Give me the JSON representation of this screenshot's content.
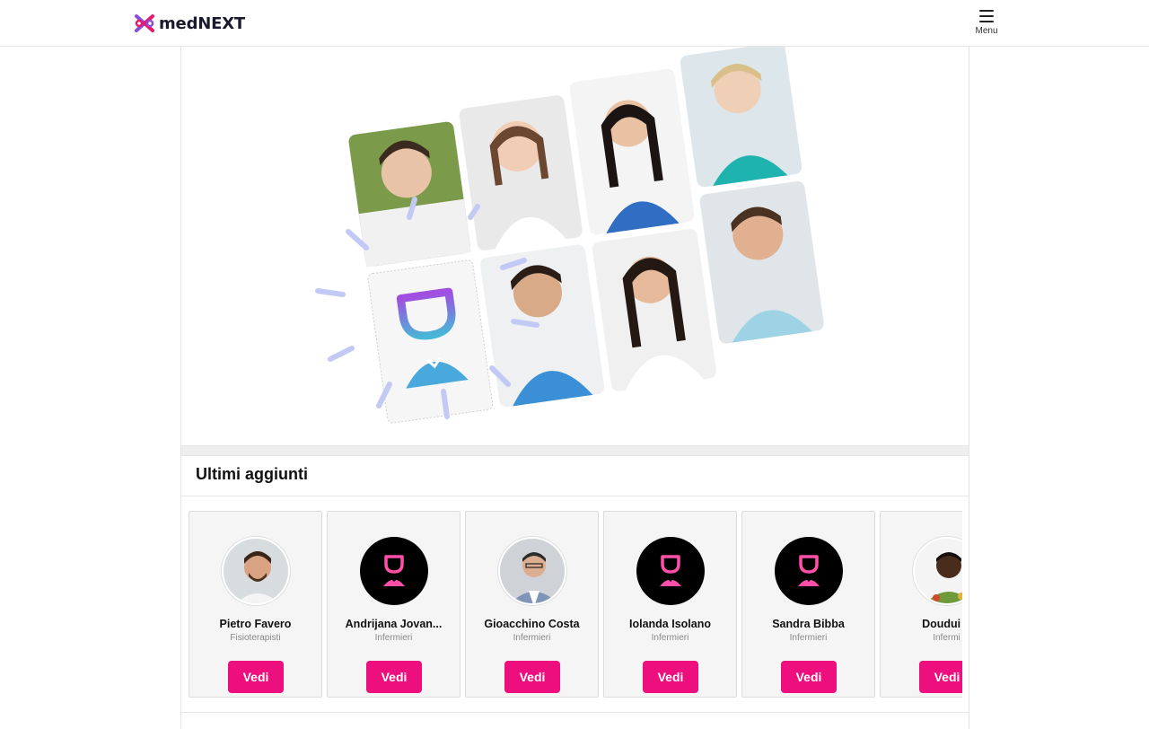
{
  "header": {
    "brand": "medNEXT",
    "menu_label": "Menu"
  },
  "colors": {
    "accent": "#ec0f7d",
    "logo_pink": "#e8186f",
    "logo_purple": "#8a4dd6",
    "placeholder_purple": "#9b4fe0",
    "placeholder_blue": "#4ab3d8"
  },
  "section": {
    "title": "Ultimi aggiunti"
  },
  "cards": [
    {
      "name": "Pietro Favero",
      "role": "Fisioterapisti",
      "button": "Vedi",
      "avatar": "photo"
    },
    {
      "name": "Andrijana Jovan...",
      "role": "Infermieri",
      "button": "Vedi",
      "avatar": "placeholder"
    },
    {
      "name": "Gioacchino Costa",
      "role": "Infermieri",
      "button": "Vedi",
      "avatar": "photo"
    },
    {
      "name": "Iolanda Isolano",
      "role": "Infermieri",
      "button": "Vedi",
      "avatar": "placeholder"
    },
    {
      "name": "Sandra Bibba",
      "role": "Infermieri",
      "button": "Vedi",
      "avatar": "placeholder"
    },
    {
      "name": "Doudui E",
      "role": "Infermi",
      "button": "Vedi",
      "avatar": "photo"
    }
  ]
}
